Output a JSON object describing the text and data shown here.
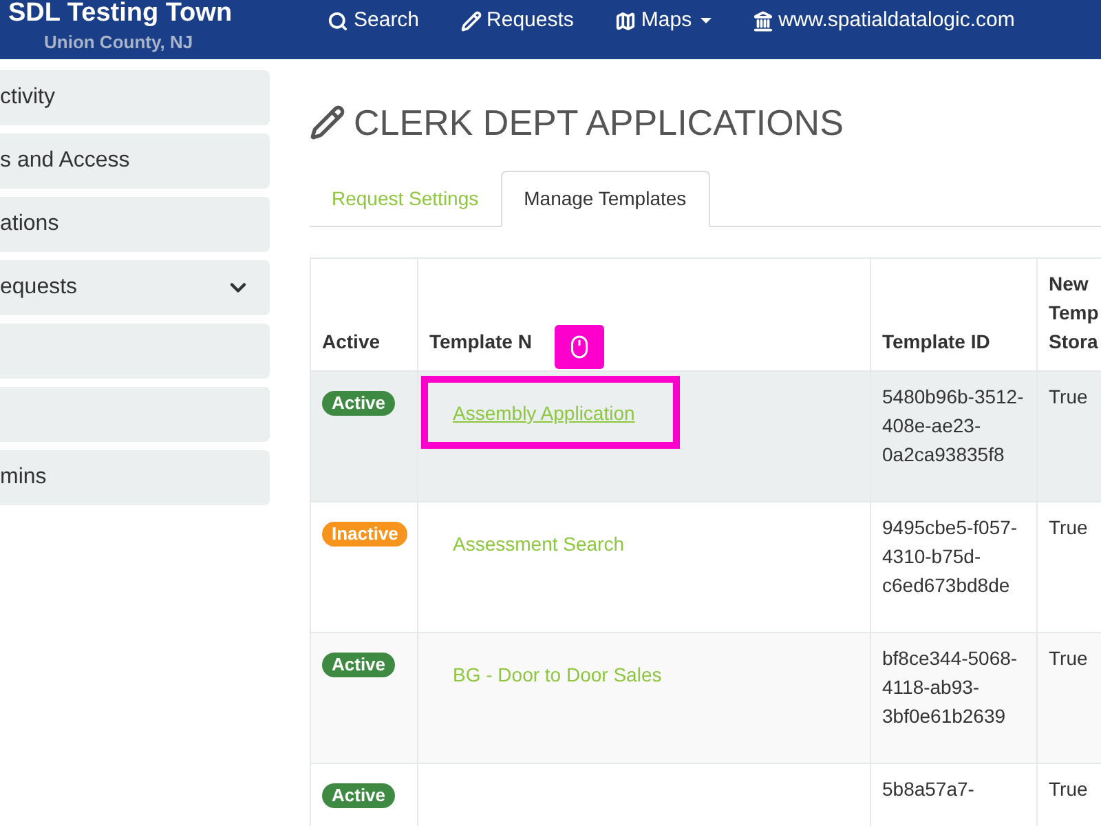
{
  "navbar": {
    "brand": "SDL Testing Town",
    "subtitle": "Union County, NJ",
    "links": [
      {
        "kind": "search",
        "label": "Search"
      },
      {
        "kind": "requests",
        "label": "Requests"
      },
      {
        "kind": "maps",
        "label": "Maps",
        "dropdown": true
      },
      {
        "kind": "site",
        "label": "www.spatialdatalogic.com"
      }
    ]
  },
  "sidebar": {
    "items": [
      {
        "kind": "link",
        "label": "ctivity"
      },
      {
        "kind": "link",
        "label": "s and Access"
      },
      {
        "kind": "link",
        "label": "ations"
      },
      {
        "kind": "link",
        "label": "equests",
        "expanded": false
      },
      {
        "kind": "blank"
      },
      {
        "kind": "blank"
      },
      {
        "kind": "link",
        "label": "mins"
      }
    ]
  },
  "page_title": "CLERK DEPT APPLICATIONS",
  "tabs": [
    {
      "label": "Request Settings",
      "selected": false
    },
    {
      "label": "Manage Templates",
      "selected": true
    }
  ],
  "table": {
    "columns": [
      "Active",
      "Template N",
      "Template ID",
      "New Temp Stora"
    ],
    "rows": [
      {
        "status": "Active",
        "active": true,
        "name": "Assembly Application",
        "template_id": "5480b96b-3512-408e-ae23-0a2ca93835f8",
        "storage": "True",
        "highlighted": true
      },
      {
        "status": "Inactive",
        "active": false,
        "name": "Assessment Search",
        "template_id": "9495cbe5-f057-4310-b75d-c6ed673bd8de",
        "storage": "True",
        "highlighted": false
      },
      {
        "status": "Active",
        "active": true,
        "name": "BG - Door to Door Sales",
        "template_id": "bf8ce344-5068-4118-ab93-3bf0e61b2639",
        "storage": "True",
        "highlighted": false
      },
      {
        "status": "Active",
        "active": true,
        "template_id": "5b8a57a7-",
        "storage": "True",
        "highlighted": false
      }
    ]
  }
}
